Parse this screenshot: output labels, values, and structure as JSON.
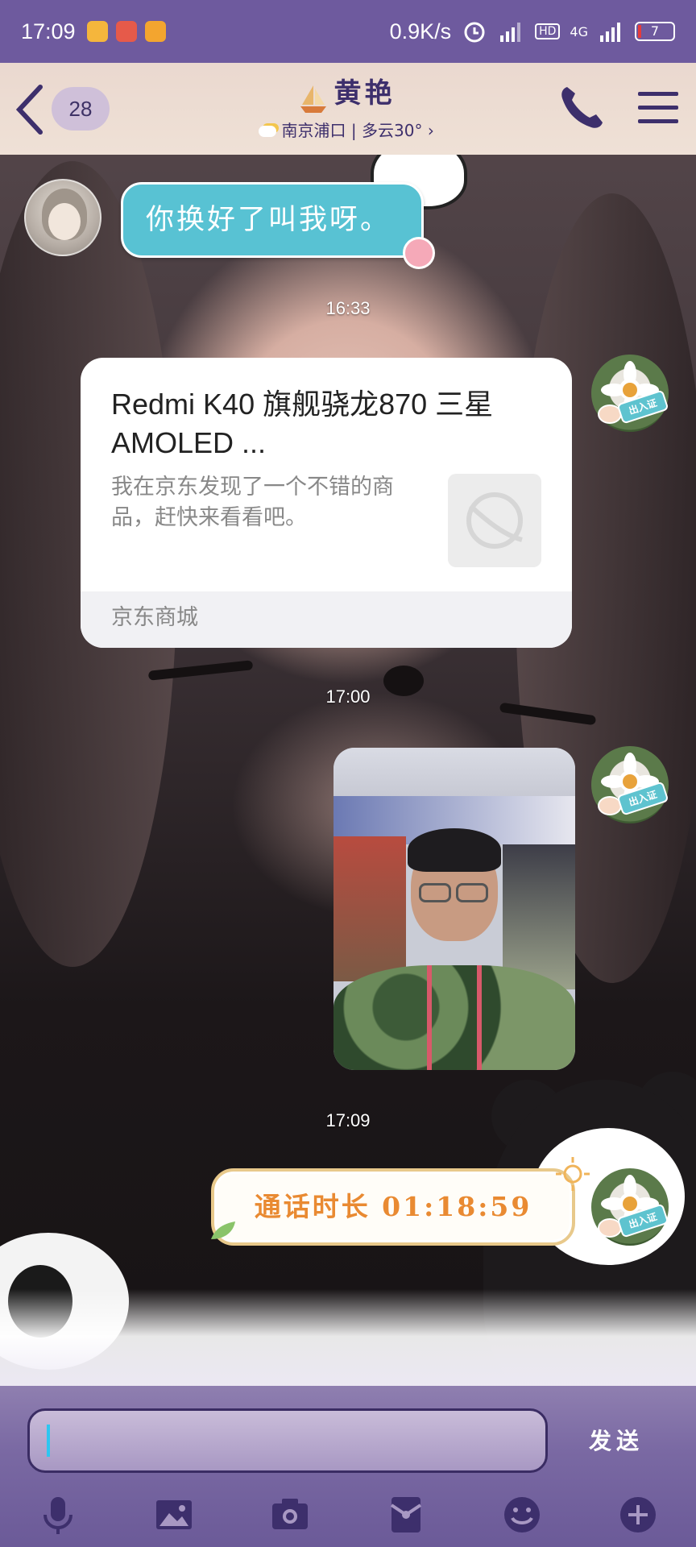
{
  "status_bar": {
    "time": "17:09",
    "net_speed": "0.9K/s",
    "hd_label": "HD",
    "network": "4G",
    "battery": "7"
  },
  "header": {
    "unread_count": "28",
    "contact_name": "黄艳",
    "subtitle": "南京浦口 | 多云30°"
  },
  "messages": {
    "incoming_text": "你换好了叫我呀。",
    "time_1": "16:33",
    "product_card": {
      "title": "Redmi K40 旗舰骁龙870 三星AMOLED ...",
      "description": "我在京东发现了一个不错的商品，赶快来看看吧。",
      "source": "京东商城"
    },
    "time_2": "17:00",
    "time_3": "17:09",
    "call_duration": "通话时长 01:18:59",
    "avatar_tag": "出入证"
  },
  "input_bar": {
    "value": "",
    "send_label": "发送"
  },
  "colors": {
    "status_bar": "#6e5a9e",
    "accent": "#3d2f6c",
    "incoming_bubble": "#58c2d3",
    "call_text": "#e98a32"
  },
  "toolbar_icons": [
    "microphone-icon",
    "image-icon",
    "camera-icon",
    "red-packet-icon",
    "emoji-icon",
    "plus-icon"
  ]
}
